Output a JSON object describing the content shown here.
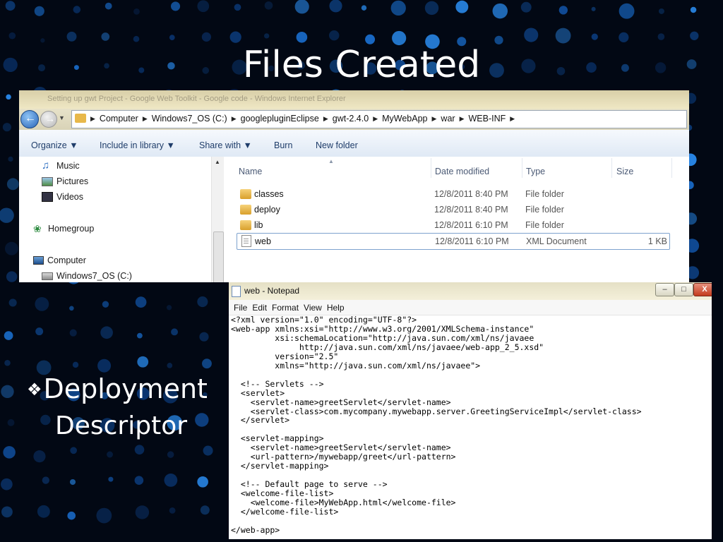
{
  "slide": {
    "title": "Files Created",
    "bullet_mark": "❖",
    "bullet_line1": "Deployment",
    "bullet_line2": "Descriptor"
  },
  "explorer": {
    "window_title": "Setting up gwt Project - Google Web Toolkit - Google code - Windows Internet Explorer",
    "breadcrumbs": [
      "Computer",
      "Windows7_OS (C:)",
      "googlepluginEclipse",
      "gwt-2.4.0",
      "MyWebApp",
      "war",
      "WEB-INF"
    ],
    "toolbar": {
      "organize": "Organize ▼",
      "include": "Include in library ▼",
      "share": "Share with ▼",
      "burn": "Burn",
      "new_folder": "New folder"
    },
    "nav": {
      "music": "Music",
      "pictures": "Pictures",
      "videos": "Videos",
      "homegroup": "Homegroup",
      "computer": "Computer",
      "drive": "Windows7_OS (C:)"
    },
    "columns": {
      "name": "Name",
      "date": "Date modified",
      "type": "Type",
      "size": "Size"
    },
    "files": [
      {
        "name": "classes",
        "date": "12/8/2011 8:40 PM",
        "type": "File folder",
        "size": ""
      },
      {
        "name": "deploy",
        "date": "12/8/2011 8:40 PM",
        "type": "File folder",
        "size": ""
      },
      {
        "name": "lib",
        "date": "12/8/2011 6:10 PM",
        "type": "File folder",
        "size": ""
      },
      {
        "name": "web",
        "date": "12/8/2011 6:10 PM",
        "type": "XML Document",
        "size": "1 KB"
      }
    ]
  },
  "notepad": {
    "title": "web - Notepad",
    "minimize": "‒",
    "maximize": "□",
    "close": "X",
    "menu": {
      "file": "File",
      "edit": "Edit",
      "format": "Format",
      "view": "View",
      "help": "Help"
    },
    "content": "<?xml version=\"1.0\" encoding=\"UTF-8\"?>\n<web-app xmlns:xsi=\"http://www.w3.org/2001/XMLSchema-instance\"\n         xsi:schemaLocation=\"http://java.sun.com/xml/ns/javaee\n              http://java.sun.com/xml/ns/javaee/web-app_2_5.xsd\"\n         version=\"2.5\"\n         xmlns=\"http://java.sun.com/xml/ns/javaee\">\n\n  <!-- Servlets -->\n  <servlet>\n    <servlet-name>greetServlet</servlet-name>\n    <servlet-class>com.mycompany.mywebapp.server.GreetingServiceImpl</servlet-class>\n  </servlet>\n\n  <servlet-mapping>\n    <servlet-name>greetServlet</servlet-name>\n    <url-pattern>/mywebapp/greet</url-pattern>\n  </servlet-mapping>\n\n  <!-- Default page to serve -->\n  <welcome-file-list>\n    <welcome-file>MyWebApp.html</welcome-file>\n  </welcome-file-list>\n\n</web-app>"
  }
}
